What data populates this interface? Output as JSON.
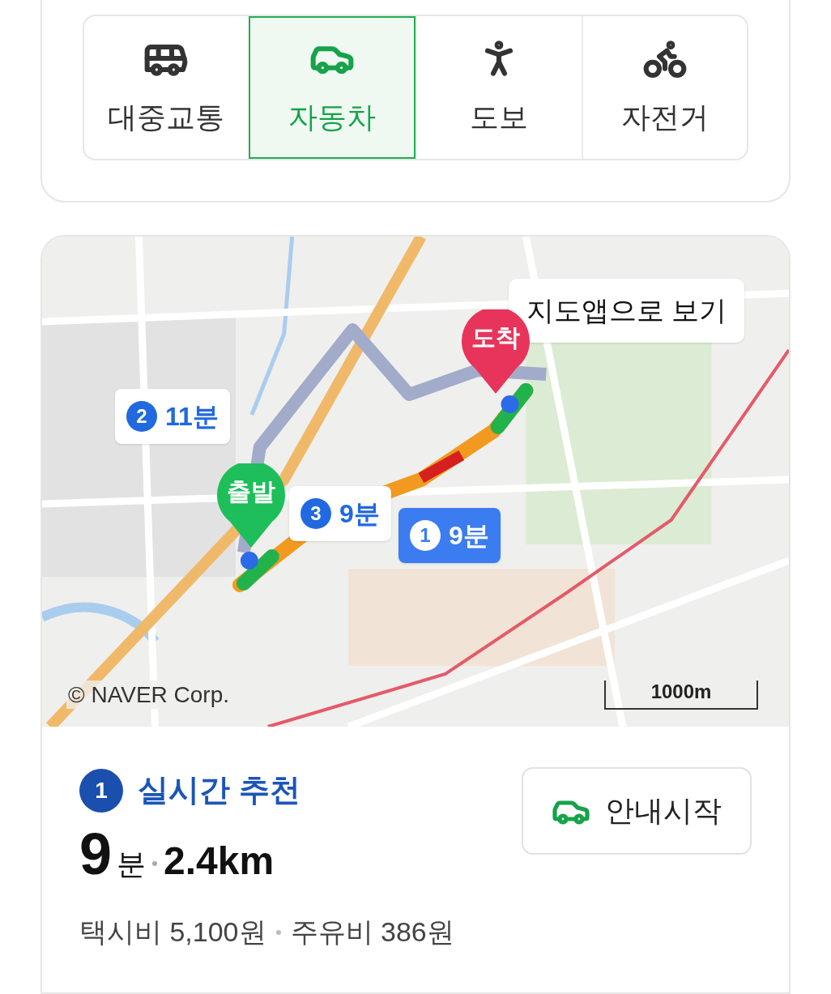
{
  "modes": [
    {
      "label": "대중교통",
      "kind": "bus",
      "selected": false
    },
    {
      "label": "자동차",
      "kind": "car",
      "selected": true
    },
    {
      "label": "도보",
      "kind": "walk",
      "selected": false
    },
    {
      "label": "자전거",
      "kind": "bike",
      "selected": false
    }
  ],
  "map": {
    "kind": "picture",
    "open_button": "지도앱으로 보기",
    "start_marker": "출발",
    "end_marker": "도착",
    "copyright": "© NAVER Corp.",
    "scale": "1000m",
    "routes": [
      {
        "number": "2",
        "time": "11분",
        "selected": false
      },
      {
        "number": "3",
        "time": "9분",
        "selected": false
      },
      {
        "number": "1",
        "time": "9분",
        "selected": true
      }
    ]
  },
  "route": {
    "number": "1",
    "title": "실시간 추천",
    "minutes": "9",
    "minutes_unit": "분",
    "distance": "2.4km",
    "taxi_fare": "택시비 5,100원",
    "fuel_cost": "주유비 386원",
    "start_button": "안내시작"
  }
}
